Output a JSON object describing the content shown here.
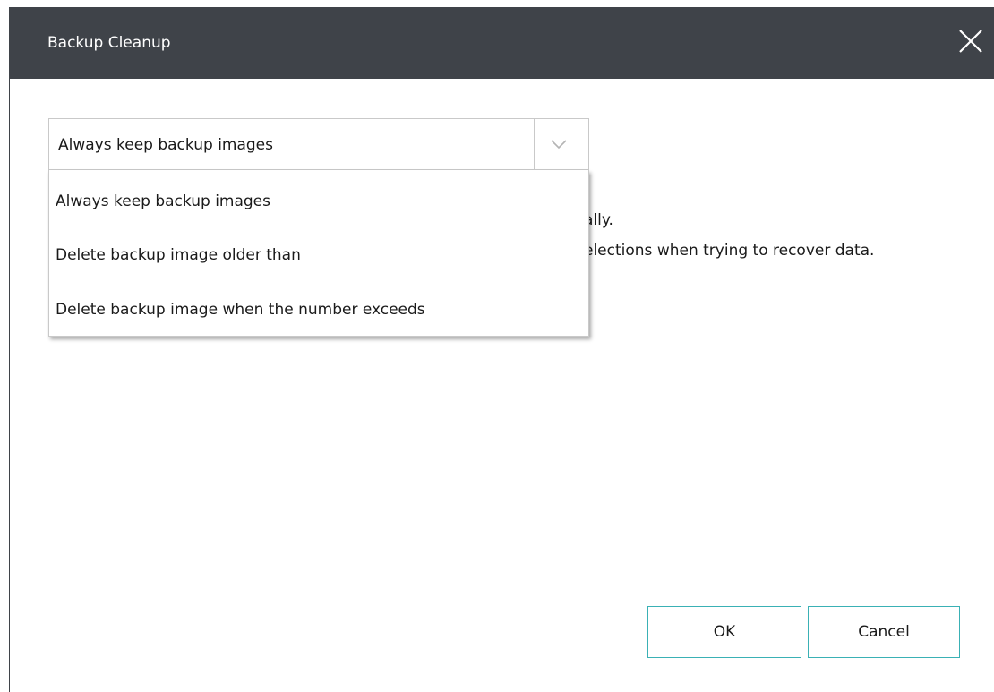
{
  "window": {
    "title": "Backup Cleanup",
    "close_icon": "close-icon"
  },
  "cleanup_select": {
    "selected": "Always keep backup images",
    "chevron_icon": "chevron-down-icon",
    "options": [
      "Always keep backup images",
      "Delete backup image older than",
      "Delete backup image when the number exceeds"
    ]
  },
  "description": {
    "line1_visible_tail": "ally.",
    "line2_visible_tail": "elections when trying to recover data."
  },
  "buttons": {
    "ok": "OK",
    "cancel": "Cancel"
  },
  "colors": {
    "titlebar": "#3f4349",
    "button_border": "#3ab1b5",
    "select_border": "#c9c9c9"
  }
}
